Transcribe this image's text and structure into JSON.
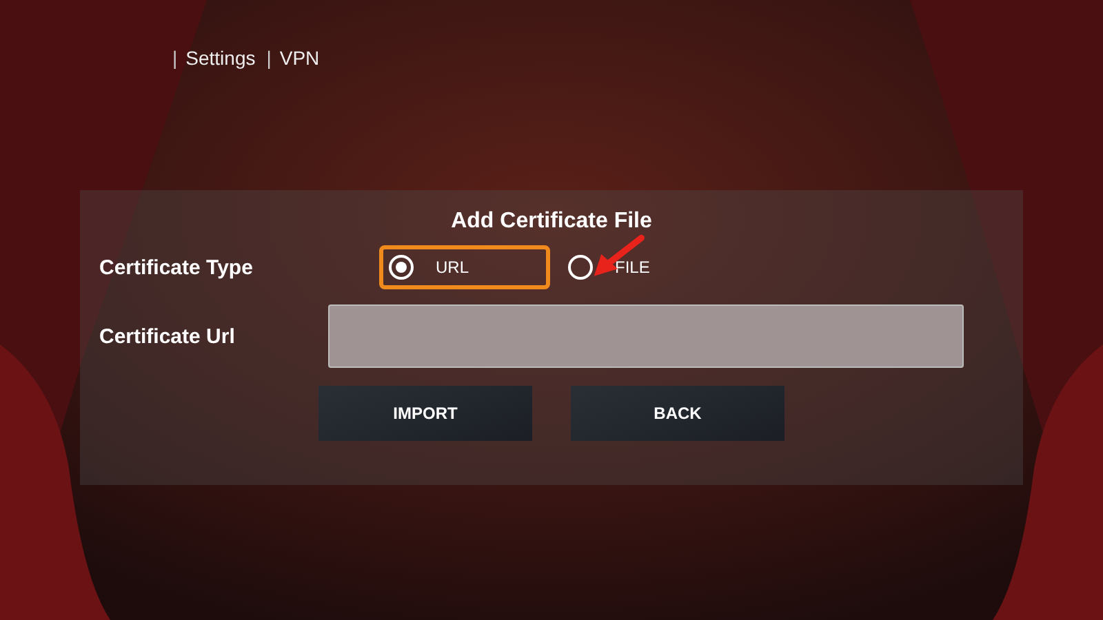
{
  "breadcrumb": [
    {
      "separator": "|",
      "label": "Settings"
    },
    {
      "separator": "|",
      "label": "VPN"
    }
  ],
  "dialog": {
    "title": "Add Certificate File",
    "type_label": "Certificate Type",
    "type_options": [
      {
        "label": "URL",
        "selected": true,
        "focused": true
      },
      {
        "label": "FILE",
        "selected": false,
        "focused": false
      }
    ],
    "url_label": "Certificate Url",
    "buttons": [
      "IMPORT",
      "BACK"
    ]
  }
}
